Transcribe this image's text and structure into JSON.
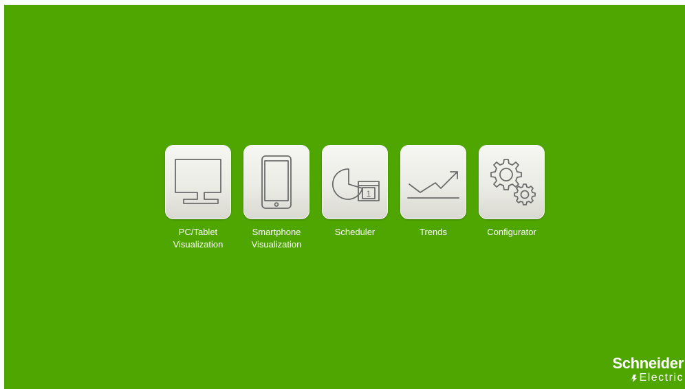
{
  "apps": [
    {
      "icon": "monitor-icon",
      "label_lines": [
        "PC/Tablet",
        "Visualization"
      ]
    },
    {
      "icon": "smartphone-icon",
      "label_lines": [
        "Smartphone",
        "Visualization"
      ]
    },
    {
      "icon": "scheduler-icon",
      "label_lines": [
        "Scheduler",
        ""
      ],
      "calendar_day": "1"
    },
    {
      "icon": "trend-chart-icon",
      "label_lines": [
        "Trends",
        ""
      ]
    },
    {
      "icon": "gears-icon",
      "label_lines": [
        "Configurator",
        ""
      ]
    }
  ],
  "brand": {
    "name": "Schneider",
    "subline": "Electric",
    "logo_icon": "schneider-logo-icon"
  },
  "colors": {
    "background": "#4fa600",
    "tile": "#ececE6",
    "icon_stroke": "#6b6b6b",
    "text": "#ffffff"
  }
}
